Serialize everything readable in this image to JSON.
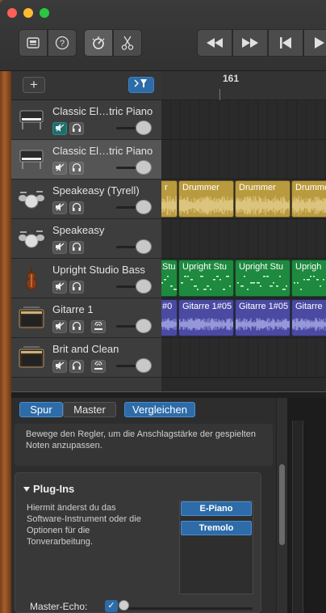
{
  "toolbar": {
    "library_icon": "library-icon",
    "help_icon": "question-icon",
    "smart_controls_icon": "dial-icon",
    "editors_icon": "scissors-icon",
    "rewind_icon": "rewind-icon",
    "forward_icon": "fast-forward-icon",
    "to_start_icon": "skip-to-start-icon",
    "play_icon": "play-icon"
  },
  "tracks_header": {
    "add_label": "+",
    "filter_icon": "region-filter-icon"
  },
  "ruler": {
    "bar_label": "161"
  },
  "tracks": [
    {
      "name": "Classic El…tric Piano",
      "icon": "piano-icon",
      "mute_active": true,
      "has_record": false
    },
    {
      "name": "Classic El…tric Piano",
      "icon": "piano-icon",
      "mute_active": false,
      "has_record": false,
      "selected": true
    },
    {
      "name": "Speakeasy (Tyrell)",
      "icon": "drum-kit-icon",
      "mute_active": false,
      "has_record": false
    },
    {
      "name": "Speakeasy",
      "icon": "drum-kit-icon",
      "mute_active": false,
      "has_record": false
    },
    {
      "name": "Upright Studio Bass",
      "icon": "upright-bass-icon",
      "mute_active": false,
      "has_record": false
    },
    {
      "name": "Gitarre 1",
      "icon": "amp-icon",
      "mute_active": false,
      "has_record": true
    },
    {
      "name": "Brit and Clean",
      "icon": "amp-icon",
      "mute_active": false,
      "has_record": true
    }
  ],
  "regions": {
    "drums": [
      "r",
      "Drummer",
      "Drummer",
      "Drummer"
    ],
    "bass": [
      "Stu",
      "Upright Stu",
      "Upright Stu",
      "Uprigh"
    ],
    "guitar": [
      "#0",
      "Gitarre 1#05",
      "Gitarre 1#05",
      "Gitarre"
    ]
  },
  "smart_controls": {
    "tab_track": "Spur",
    "tab_master": "Master",
    "compare": "Vergleichen",
    "hint": "Bewege den Regler, um die Anschlagstärke der gespielten Noten anzupassen.",
    "plugins_title": "Plug-Ins",
    "plugins_desc": "Hiermit änderst du das Software-Instrument oder die Optionen für die Tonverarbeitung.",
    "slots": [
      "E-Piano",
      "Tremolo"
    ],
    "master_echo_label": "Master-Echo:",
    "master_echo_checked": "✓"
  }
}
